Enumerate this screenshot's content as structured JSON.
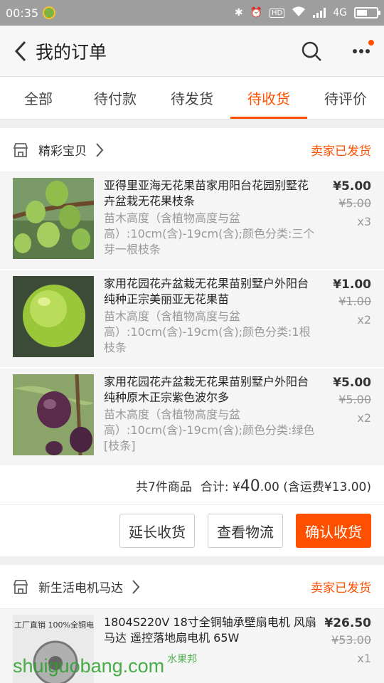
{
  "status": {
    "time": "00:35",
    "network": "4G",
    "hd": "HD"
  },
  "header": {
    "title": "我的订单"
  },
  "tabs": [
    {
      "label": "全部"
    },
    {
      "label": "待付款"
    },
    {
      "label": "待发货"
    },
    {
      "label": "待收货",
      "active": true
    },
    {
      "label": "待评价"
    }
  ],
  "orders": [
    {
      "shop": "精彩宝贝",
      "status": "卖家已发货",
      "items": [
        {
          "title": "亚得里亚海无花果苗家用阳台花园别墅花卉盆栽无花果枝条",
          "spec": "苗木高度（含植物高度与盆高）:10cm(含)-19cm(含);颜色分类:三个芽一根枝条",
          "price": "¥5.00",
          "orig": "¥5.00",
          "qty": "x3"
        },
        {
          "title": "家用花园花卉盆栽无花果苗别墅户外阳台纯种正宗美丽亚无花果苗",
          "spec": "苗木高度（含植物高度与盆高）:10cm(含)-19cm(含);颜色分类:1根枝条",
          "price": "¥1.00",
          "orig": "¥1.00",
          "qty": "x2"
        },
        {
          "title": "家用花园花卉盆栽无花果苗别墅户外阳台纯种原木正宗紫色波尔多",
          "spec": "苗木高度（含植物高度与盆高）:10cm(含)-19cm(含);颜色分类:绿色[枝条]",
          "price": "¥5.00",
          "orig": "¥5.00",
          "qty": "x2"
        }
      ],
      "summary": {
        "count": "共7件商品",
        "total_label": "合计:",
        "currency": "¥",
        "total_int": "40",
        "total_dec": ".00",
        "shipping": "(含运费¥13.00)"
      },
      "actions": {
        "extend": "延长收货",
        "logistics": "查看物流",
        "confirm": "确认收货"
      }
    },
    {
      "shop": "新生活电机马达",
      "status": "卖家已发货",
      "items": [
        {
          "title": "1804S220V 18寸全铜轴承壁扇电机 风扇马达 遥控落地扇电机 65W",
          "spec": "",
          "price": "¥26.50",
          "orig": "¥53.00",
          "qty": "x1"
        }
      ]
    }
  ],
  "watermark": {
    "text": "shuiguobang.com",
    "tag": "水果邦"
  },
  "product_image_text": "工厂直销 100%全铜电机"
}
